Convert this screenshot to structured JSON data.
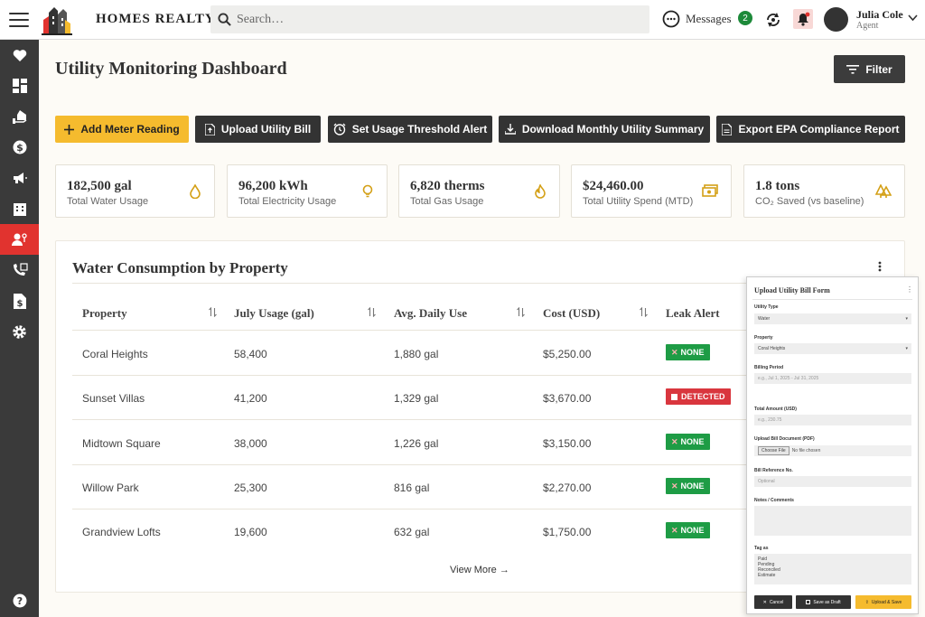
{
  "header": {
    "brand": "HOMES REALTY",
    "search_placeholder": "Search…",
    "messages_label": "Messages",
    "messages_count": "2",
    "user_name": "Julia Cole",
    "user_role": "Agent"
  },
  "colors": {
    "accent": "#f5bb2e",
    "sidebar": "#3a3a3a",
    "sidebar_active": "#e1332f",
    "leak_none": "#1e9c45",
    "leak_detected": "#d9363e"
  },
  "page": {
    "title": "Utility Monitoring Dashboard",
    "filter_label": "Filter"
  },
  "actions": [
    {
      "label": "Add Meter Reading",
      "icon": "plus-icon"
    },
    {
      "label": "Upload Utility Bill",
      "icon": "upload-file-icon"
    },
    {
      "label": "Set Usage Threshold Alert",
      "icon": "alarm-clock-icon"
    },
    {
      "label": "Download Monthly Utility Summary",
      "icon": "download-icon"
    },
    {
      "label": "Export EPA Compliance Report",
      "icon": "document-icon"
    }
  ],
  "stats": [
    {
      "value": "182,500 gal",
      "label": "Total Water Usage",
      "icon": "water-drop-icon"
    },
    {
      "value": "96,200 kWh",
      "label": "Total Electricity Usage",
      "icon": "lightbulb-icon"
    },
    {
      "value": "6,820 therms",
      "label": "Total Gas Usage",
      "icon": "flame-icon"
    },
    {
      "value": "$24,460.00",
      "label": "Total Utility Spend (MTD)",
      "icon": "money-icon"
    },
    {
      "value": "1.8 tons",
      "label": "CO₂ Saved (vs baseline)",
      "icon": "trees-icon"
    }
  ],
  "table": {
    "title": "Water Consumption by Property",
    "columns": [
      "Property",
      "July Usage (gal)",
      "Avg. Daily Use",
      "Cost (USD)",
      "Leak Alert"
    ],
    "rows": [
      {
        "property": "Coral Heights",
        "usage": "58,400",
        "avg": "1,880 gal",
        "cost": "$5,250.00",
        "leak": "NONE"
      },
      {
        "property": "Sunset Villas",
        "usage": "41,200",
        "avg": "1,329 gal",
        "cost": "$3,670.00",
        "leak": "DETECTED"
      },
      {
        "property": "Midtown Square",
        "usage": "38,000",
        "avg": "1,226 gal",
        "cost": "$3,150.00",
        "leak": "NONE"
      },
      {
        "property": "Willow Park",
        "usage": "25,300",
        "avg": "816 gal",
        "cost": "$2,270.00",
        "leak": "NONE"
      },
      {
        "property": "Grandview Lofts",
        "usage": "19,600",
        "avg": "632 gal",
        "cost": "$1,750.00",
        "leak": "NONE"
      }
    ],
    "view_more": "View More →"
  },
  "form": {
    "title": "Upload Utility Bill Form",
    "utility_type_label": "Utility Type",
    "utility_type_value": "Water",
    "property_label": "Property",
    "property_value": "Coral Heights",
    "billing_period_label": "Billing Period",
    "billing_period_placeholder": "e.g., Jul 1, 2025 - Jul 31, 2025",
    "total_amount_label": "Total Amount (USD)",
    "total_amount_placeholder": "e.g., 230.75",
    "upload_label": "Upload Bill Document (PDF)",
    "choose_file": "Choose File",
    "no_file": "No file chosen",
    "ref_label": "Bill Reference No.",
    "ref_placeholder": "Optional",
    "notes_label": "Notes / Comments",
    "tag_label": "Tag as",
    "tags": [
      "Paid",
      "Pending",
      "Reconciled",
      "Estimate"
    ],
    "cancel": "Cancel",
    "save_draft": "Save as Draft",
    "upload_save": "Upload & Save"
  }
}
